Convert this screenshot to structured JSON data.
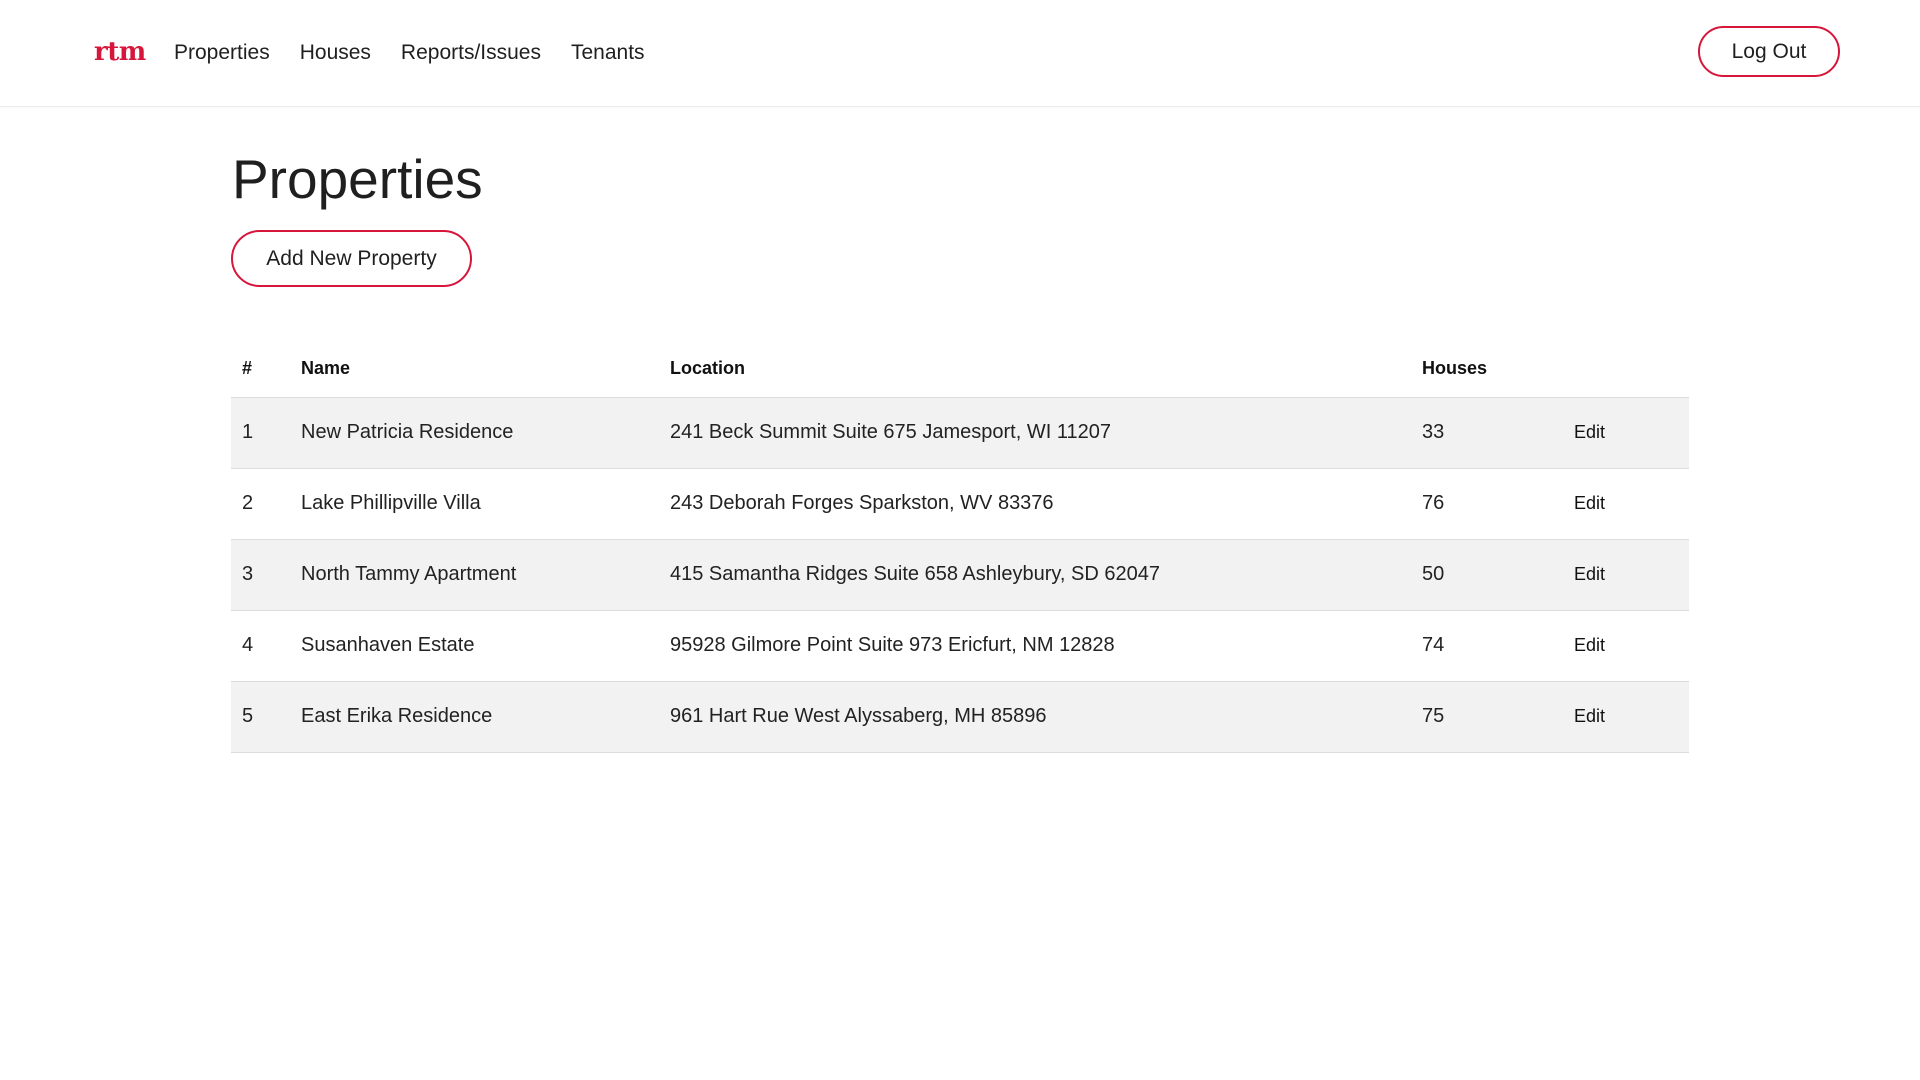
{
  "nav": {
    "logo": "rtm",
    "links": [
      "Properties",
      "Houses",
      "Reports/Issues",
      "Tenants"
    ],
    "logout_label": "Log Out"
  },
  "page": {
    "title": "Properties",
    "add_button_label": "Add New Property"
  },
  "table": {
    "headers": [
      "#",
      "Name",
      "Location",
      "Houses",
      ""
    ],
    "rows": [
      {
        "num": "1",
        "name": "New Patricia Residence",
        "location": "241 Beck Summit Suite 675 Jamesport, WI 11207",
        "houses": "33",
        "action": "Edit"
      },
      {
        "num": "2",
        "name": "Lake Phillipville Villa",
        "location": "243 Deborah Forges Sparkston, WV 83376",
        "houses": "76",
        "action": "Edit"
      },
      {
        "num": "3",
        "name": "North Tammy Apartment",
        "location": "415 Samantha Ridges Suite 658 Ashleybury, SD 62047",
        "houses": "50",
        "action": "Edit"
      },
      {
        "num": "4",
        "name": "Susanhaven Estate",
        "location": "95928 Gilmore Point Suite 973 Ericfurt, NM 12828",
        "houses": "74",
        "action": "Edit"
      },
      {
        "num": "5",
        "name": "East Erika Residence",
        "location": "961 Hart Rue West Alyssaberg, MH 85896",
        "houses": "75",
        "action": "Edit"
      }
    ]
  },
  "colors": {
    "accent": "#d6163a",
    "row_stripe": "#f2f2f2"
  }
}
